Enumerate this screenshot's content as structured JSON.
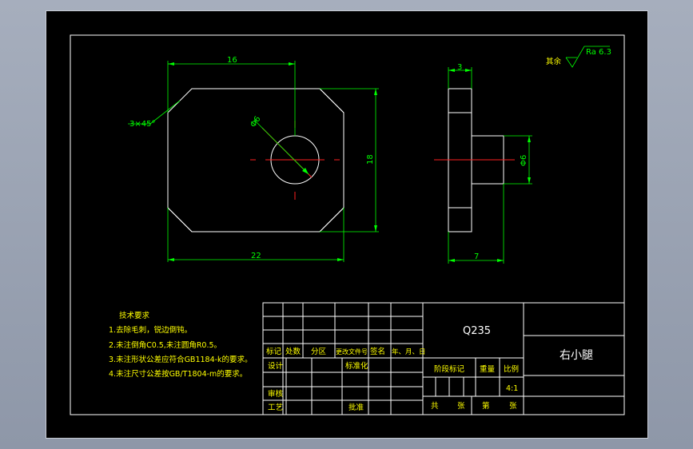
{
  "dimensions": {
    "top_width": "16",
    "bottom_width": "22",
    "height": "18",
    "chamfer": "3×45°",
    "hole_diameter": "Φ6",
    "side_thickness": "3",
    "side_total": "7",
    "boss_diameter": "Φ6"
  },
  "roughness": {
    "label": "其余",
    "value": "Ra 6.3"
  },
  "notes": {
    "title": "技术要求",
    "items": [
      "1.去除毛刺，锐边倒钝。",
      "2.未注倒角C0.5,未注圆角R0.5。",
      "3.未注形状公差应符合GB1184-k的要求。",
      "4.未注尺寸公差按GB/T1804-m的要求。"
    ]
  },
  "title_block": {
    "material": "Q235",
    "part_name": "右小腿",
    "headers": [
      "标记",
      "处数",
      "分区",
      "更改文件号",
      "签名",
      "年、月、日"
    ],
    "design": "设计",
    "standardization": "标准化",
    "review": "审核",
    "process": "工艺",
    "approve": "批准",
    "stage_mark": "阶段标记",
    "weight": "重量",
    "ratio_label": "比例",
    "ratio": "4:1",
    "total": "共",
    "sheet_unit": "张",
    "nth": "第",
    "sheet_unit2": "张"
  }
}
